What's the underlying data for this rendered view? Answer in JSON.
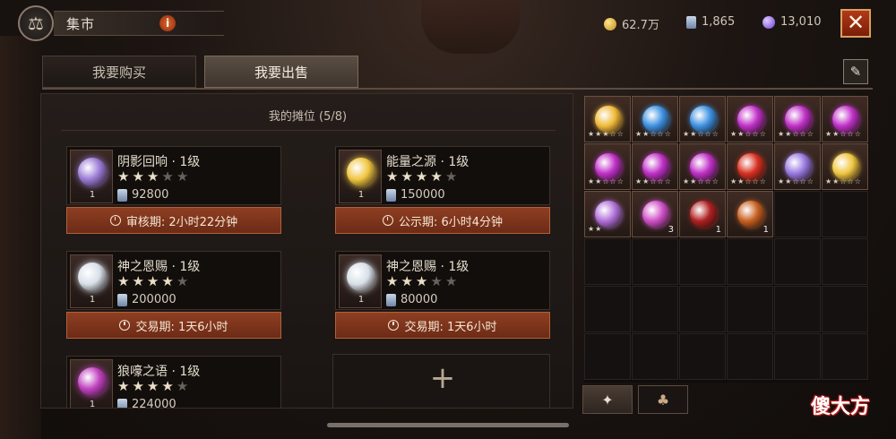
{
  "header": {
    "title": "集市",
    "info_glyph": "i",
    "currencies": [
      {
        "icon": "gold-coin-icon",
        "value": "62.7万"
      },
      {
        "icon": "scroll-icon",
        "value": "1,865"
      },
      {
        "icon": "gem-icon",
        "value": "13,010"
      }
    ],
    "close_glyph": "✕"
  },
  "tabs": {
    "buy_label": "我要购买",
    "sell_label": "我要出售",
    "active": "sell"
  },
  "panel": {
    "title": "我的摊位 (5/8)"
  },
  "slots": [
    {
      "name": "阴影回响 · 1级",
      "stars": 3,
      "max_stars": 5,
      "qty": "1",
      "price": "92800",
      "timer": "审核期: 2小时22分钟",
      "orb_color": "#9a7bd6"
    },
    {
      "name": "能量之源 · 1级",
      "stars": 4,
      "max_stars": 5,
      "qty": "1",
      "price": "150000",
      "timer": "公示期: 6小时4分钟",
      "orb_color": "#f0c640"
    },
    {
      "name": "神之恩赐 · 1级",
      "stars": 4,
      "max_stars": 5,
      "qty": "1",
      "price": "200000",
      "timer": "交易期: 1天6小时",
      "orb_color": "#d8e0e8"
    },
    {
      "name": "神之恩赐 · 1级",
      "stars": 3,
      "max_stars": 5,
      "qty": "1",
      "price": "80000",
      "timer": "交易期: 1天6小时",
      "orb_color": "#d8e0e8"
    },
    {
      "name": "狼嚎之语 · 1级",
      "stars": 4,
      "max_stars": 5,
      "qty": "1",
      "price": "224000",
      "timer": "",
      "orb_color": "#c040c0"
    }
  ],
  "add_slot": {
    "glyph": "+"
  },
  "inventory": [
    {
      "color": "#f0b838",
      "stars": "★★★☆☆",
      "count": ""
    },
    {
      "color": "#3c90e0",
      "stars": "★★☆☆☆",
      "count": ""
    },
    {
      "color": "#3c90e0",
      "stars": "★★☆☆☆",
      "count": ""
    },
    {
      "color": "#c030c8",
      "stars": "★★☆☆☆",
      "count": ""
    },
    {
      "color": "#c030c8",
      "stars": "★★☆☆☆",
      "count": ""
    },
    {
      "color": "#c030c8",
      "stars": "★★☆☆☆",
      "count": ""
    },
    {
      "color": "#c030c8",
      "stars": "★★☆☆☆",
      "count": ""
    },
    {
      "color": "#c030c8",
      "stars": "★★☆☆☆",
      "count": ""
    },
    {
      "color": "#c030c8",
      "stars": "★★☆☆☆",
      "count": ""
    },
    {
      "color": "#d83020",
      "stars": "★★☆☆☆",
      "count": ""
    },
    {
      "color": "#9878e0",
      "stars": "★★☆☆☆",
      "count": ""
    },
    {
      "color": "#f0c640",
      "stars": "★★☆☆☆",
      "count": ""
    },
    {
      "color": "#b070d8",
      "stars": "★★",
      "count": ""
    },
    {
      "color": "#d050c8",
      "stars": "",
      "count": "3"
    },
    {
      "color": "#b02020",
      "stars": "",
      "count": "1"
    },
    {
      "color": "#c86020",
      "stars": "",
      "count": "1"
    }
  ],
  "watermark": "傻大方"
}
